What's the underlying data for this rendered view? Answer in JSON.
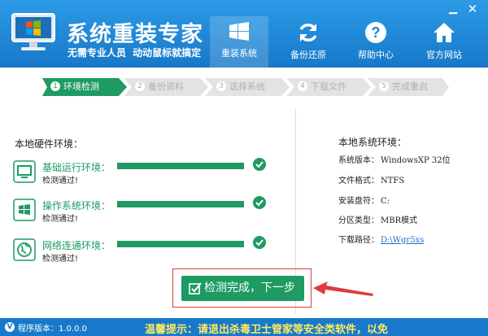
{
  "header": {
    "title": "系统重装专家",
    "subtitle": "无需专业人员 动动鼠标就搞定",
    "minimize_icon": "minimize-icon",
    "close_icon": "close-icon"
  },
  "nav": [
    {
      "label": "重装系统",
      "icon": "windows-icon",
      "active": true
    },
    {
      "label": "备份还原",
      "icon": "refresh-icon",
      "active": false
    },
    {
      "label": "帮助中心",
      "icon": "question-icon",
      "active": false
    },
    {
      "label": "官方网站",
      "icon": "home-icon",
      "active": false
    }
  ],
  "steps": [
    {
      "num": "1",
      "label": "环境检测",
      "active": true
    },
    {
      "num": "2",
      "label": "备份资料",
      "active": false
    },
    {
      "num": "3",
      "label": "选择系统",
      "active": false
    },
    {
      "num": "4",
      "label": "下载文件",
      "active": false
    },
    {
      "num": "5",
      "label": "完成重启",
      "active": false
    }
  ],
  "hardware": {
    "title": "本地硬件环境：",
    "items": [
      {
        "label": "基础运行环境：",
        "status": "检测通过!",
        "icon": "monitor-icon",
        "progress": 1.0
      },
      {
        "label": "操作系统环境：",
        "status": "检测通过!",
        "icon": "windows-logo-icon",
        "progress": 1.0
      },
      {
        "label": "网络连通环境：",
        "status": "检测通过!",
        "icon": "globe-icon",
        "progress": 1.0
      }
    ]
  },
  "system": {
    "title": "本地系统环境：",
    "rows": [
      {
        "label": "系统版本：",
        "value": "WindowsXP  32位"
      },
      {
        "label": "文件格式：",
        "value": "NTFS"
      },
      {
        "label": "安装盘符：",
        "value": "C:"
      },
      {
        "label": "分区类型：",
        "value": "MBR模式"
      },
      {
        "label": "下载路径：",
        "value": "D:\\Wgr5xs",
        "link": true
      }
    ]
  },
  "next_button": {
    "label": "检测完成，下一步"
  },
  "footer": {
    "version": "程序版本：1.0.0.0",
    "tip": "温馨提示：请退出杀毒卫士管家等安全类软件，以免"
  },
  "colors": {
    "brand_blue": "#1e88d8",
    "accent_green": "#1e9a63",
    "highlight_red": "#e03a3a"
  }
}
